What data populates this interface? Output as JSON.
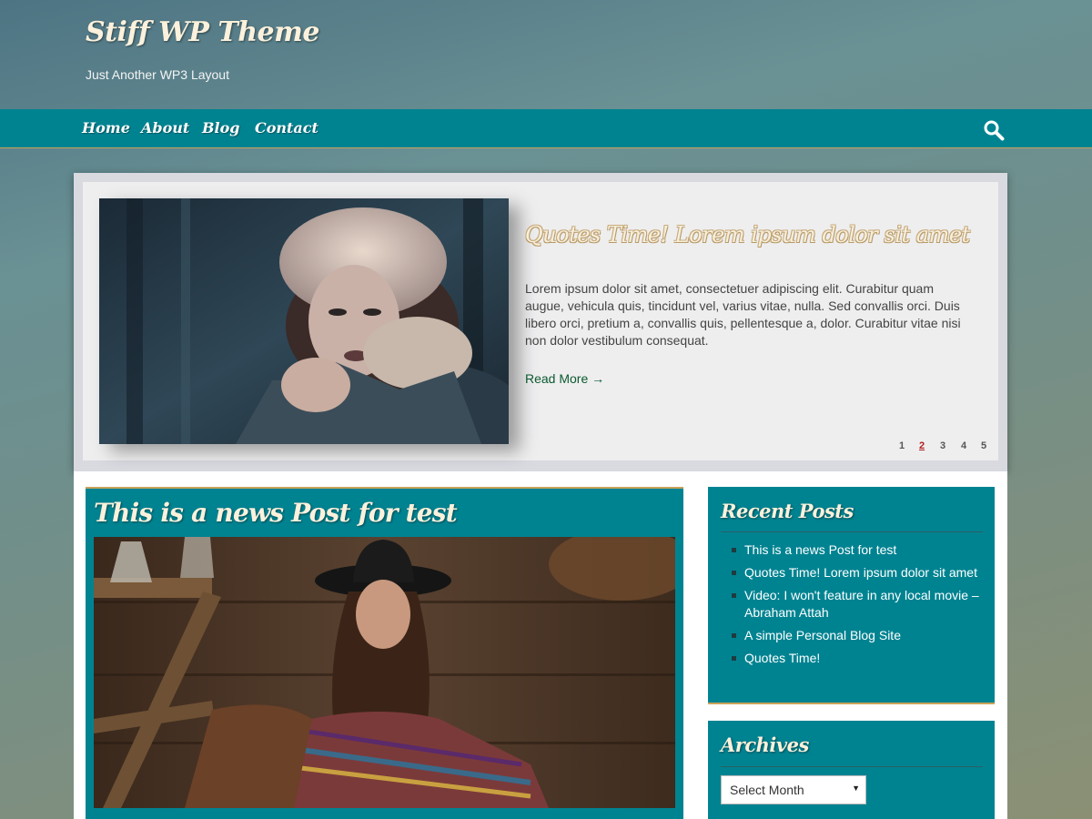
{
  "header": {
    "site_title": "Stiff WP Theme",
    "tagline": "Just Another WP3 Layout"
  },
  "nav": {
    "items": [
      {
        "label": "Home"
      },
      {
        "label": "About"
      },
      {
        "label": "Blog"
      },
      {
        "label": "Contact"
      }
    ],
    "search_icon": "search-icon"
  },
  "slider": {
    "title": "Quotes Time! Lorem ipsum dolor sit amet",
    "excerpt": "Lorem ipsum dolor sit amet, consectetuer adipiscing elit. Curabitur quam augue, vehicula quis, tincidunt vel, varius vitae, nulla. Sed convallis orci. Duis libero orci, pretium a, convallis quis, pellentesque a, dolor. Curabitur vitae nisi non dolor vestibulum consequat.",
    "read_more": "Read More →",
    "pages": [
      "1",
      "2",
      "3",
      "4",
      "5"
    ],
    "active_page": "2"
  },
  "post": {
    "title": "This is a news Post for test"
  },
  "sidebar": {
    "recent_posts": {
      "title": "Recent Posts",
      "items": [
        "This is a news Post for test",
        "Quotes Time! Lorem ipsum dolor sit amet",
        "Video: I won't feature in any local movie – Abraham Attah",
        "A simple Personal Blog Site",
        "Quotes Time!"
      ]
    },
    "archives": {
      "title": "Archives",
      "select_value": "Select Month"
    }
  },
  "colors": {
    "accent": "#008391",
    "gold": "#c9a25a",
    "title_cream": "#fbf1dc"
  }
}
